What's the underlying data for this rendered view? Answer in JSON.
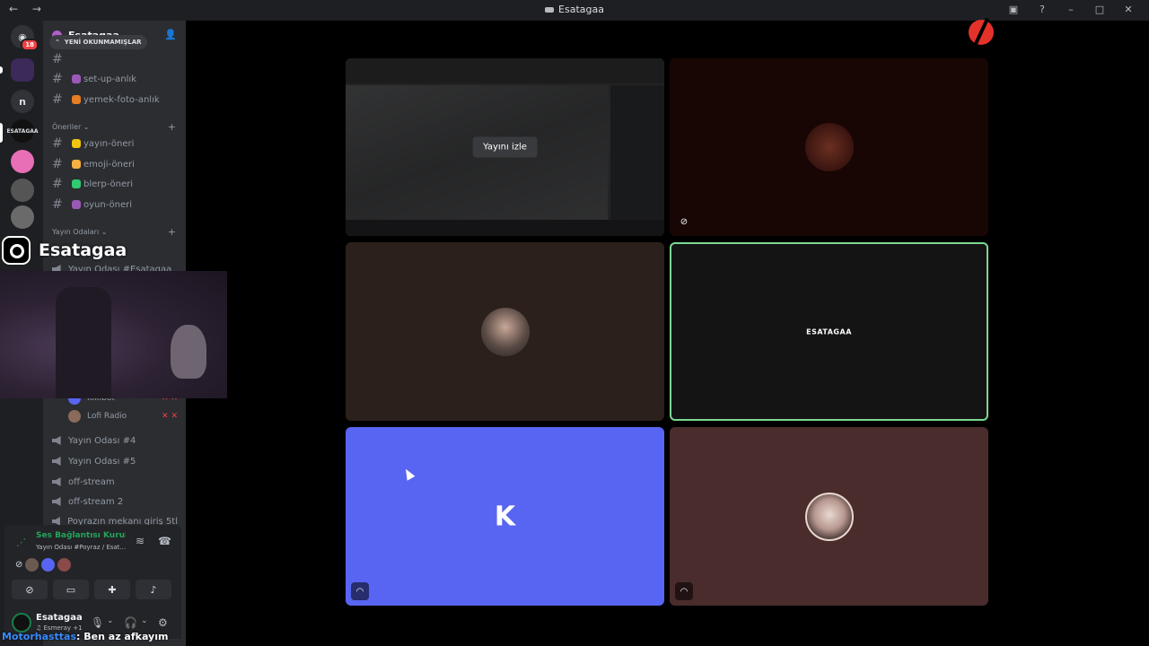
{
  "window": {
    "title": "Esatagaa"
  },
  "guilds": {
    "home_badge": "18",
    "item_n": "n",
    "item_esatagaa": "ESATAGAA"
  },
  "server": {
    "name": "Esatagaa"
  },
  "unread_pill": "YENİ OKUNMAMIŞLAR",
  "channels_top": [
    {
      "name": "set-up-anlık",
      "emoji_color": "#9b59b6"
    },
    {
      "name": "yemek-foto-anlık",
      "emoji_color": "#e67e22"
    }
  ],
  "categories": {
    "suggestions": "Öneriler",
    "stream_rooms": "Yayın Odaları"
  },
  "channels_suggestions": [
    {
      "name": "yayın-öneri",
      "emoji_color": "#f1c40f"
    },
    {
      "name": "emoji-öneri",
      "emoji_color": "#f5b041"
    },
    {
      "name": "blerp-öneri",
      "emoji_color": "#2ecc71"
    },
    {
      "name": "oyun-öneri",
      "emoji_color": "#9b59b6"
    }
  ],
  "voice_channel_partial": "Yayın Odası #Esatagaa",
  "members": [
    {
      "name": "Kikibot",
      "color": "#5865f2"
    },
    {
      "name": "Lofi Radio",
      "color": "#8a6a5a"
    }
  ],
  "voice_channels": [
    "Yayın Odası #4",
    "Yayın Odası #5",
    "off-stream",
    "off-stream 2",
    "Poyrazın mekanı giriş 5tl"
  ],
  "voice_panel": {
    "status": "Ses Bağlantısı Kuruldu",
    "channel": "Yayın Odası #Poyraz / Esat..."
  },
  "user_panel": {
    "name": "Esatagaa",
    "status": "♫ Esmeray +1"
  },
  "overlay": {
    "instagram_name": "Esatagaa",
    "chat_user": "Motorhasttas",
    "chat_message": ": Ben az afkayım"
  },
  "stage": {
    "watch_stream_label": "Yayını izle",
    "tile_label": "ESATAGAA"
  },
  "colors": {
    "accent": "#5865f2",
    "speaking": "#7cd992",
    "connected": "#23a55a",
    "danger": "#f23f43"
  }
}
